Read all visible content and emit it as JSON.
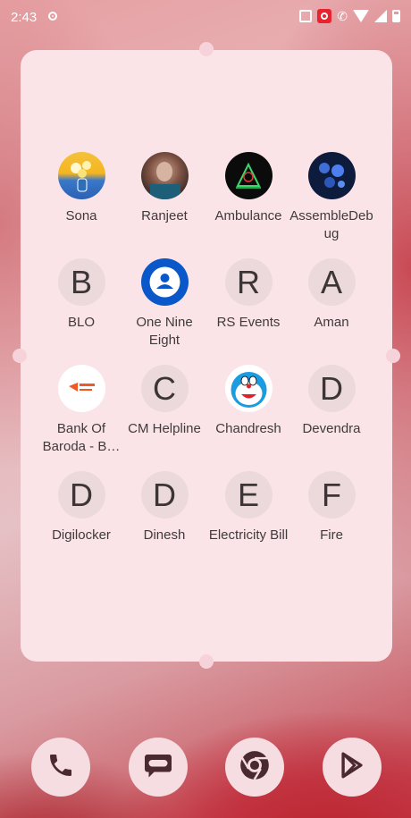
{
  "status_bar": {
    "time": "2:43",
    "icons": [
      "record-indicator-icon",
      "vibrate-icon",
      "screen-record-icon",
      "wifi-call-icon",
      "wifi-icon",
      "signal-icon",
      "battery-icon"
    ]
  },
  "apps": [
    {
      "label": "Sona",
      "icon": "avatar-flowers"
    },
    {
      "label": "Ranjeet",
      "icon": "avatar-photo"
    },
    {
      "label": "Ambulance",
      "icon": "avatar-dark-art"
    },
    {
      "label": "AssembleDebug",
      "icon": "avatar-blue-flowers"
    },
    {
      "label": "BLO",
      "letter": "B"
    },
    {
      "label": "One Nine Eight",
      "icon": "contact-blue"
    },
    {
      "label": "RS Events",
      "letter": "R"
    },
    {
      "label": "Aman",
      "letter": "A"
    },
    {
      "label": "Bank Of Baroda - B…",
      "icon": "bank-of-baroda-logo"
    },
    {
      "label": "CM Helpline",
      "letter": "C"
    },
    {
      "label": "Chandresh",
      "icon": "doraemon-avatar"
    },
    {
      "label": "Devendra",
      "letter": "D"
    },
    {
      "label": "Digilocker",
      "letter": "D"
    },
    {
      "label": "Dinesh",
      "letter": "D"
    },
    {
      "label": "Electricity Bill",
      "letter": "E"
    },
    {
      "label": "Fire",
      "letter": "F"
    }
  ],
  "dock": [
    {
      "name": "phone-icon"
    },
    {
      "name": "messages-icon"
    },
    {
      "name": "chrome-icon"
    },
    {
      "name": "play-store-icon"
    }
  ],
  "colors": {
    "widget_bg": "#fbe4e8",
    "letter_bg": "#ecd9dc",
    "dock_bg": "#f6dde1",
    "icon_dark": "#4a2a30"
  }
}
